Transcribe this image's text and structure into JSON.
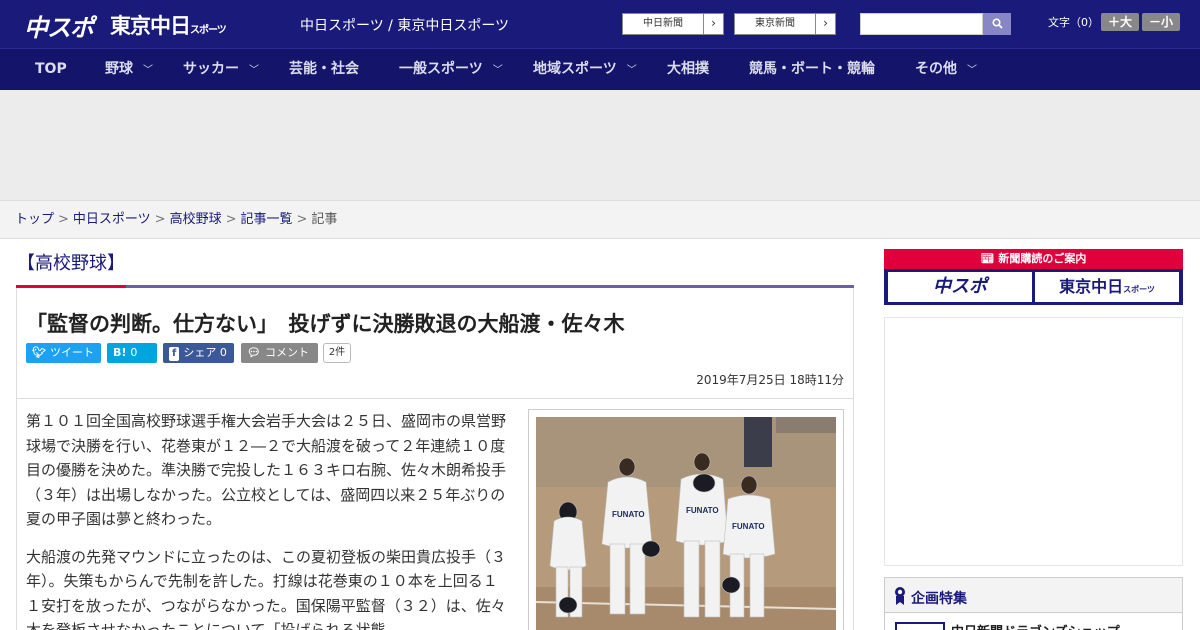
{
  "header": {
    "logo_chunichi": "中スポ",
    "logo_tokyo": "東京中日",
    "logo_tokyo_small": "スポーツ",
    "site_names": "中日スポーツ / 東京中日スポーツ",
    "link_chunichi_shimbun": "中日新聞",
    "link_tokyo_shimbun": "東京新聞",
    "search_placeholder": "",
    "fontsize_label": "文字（0）",
    "fontsize_up": "＋大",
    "fontsize_down": "－小"
  },
  "nav": {
    "items": [
      {
        "label": "TOP",
        "has_dropdown": false
      },
      {
        "label": "野球",
        "has_dropdown": true
      },
      {
        "label": "サッカー",
        "has_dropdown": true
      },
      {
        "label": "芸能・社会",
        "has_dropdown": false
      },
      {
        "label": "一般スポーツ",
        "has_dropdown": true
      },
      {
        "label": "地域スポーツ",
        "has_dropdown": true
      },
      {
        "label": "大相撲",
        "has_dropdown": false
      },
      {
        "label": "競馬・ボート・競輪",
        "has_dropdown": false
      },
      {
        "label": "その他",
        "has_dropdown": true
      }
    ]
  },
  "breadcrumb": {
    "items": [
      "トップ",
      "中日スポーツ",
      "高校野球",
      "記事一覧"
    ],
    "current": "記事",
    "separator": ">"
  },
  "article": {
    "category": "【高校野球】",
    "headline": "「監督の判断。仕方ない」　投げずに決勝敗退の大船渡・佐々木",
    "social": {
      "tweet": "ツイート",
      "hatena_icon": "B!",
      "hatena_count": "0",
      "facebook_label": "シェア",
      "facebook_count": "0",
      "comment_label": "コメント",
      "comment_count": "2件"
    },
    "date": "2019年7月25日 18時11分",
    "paragraphs": [
      "第１０１回全国高校野球選手権大会岩手大会は２５日、盛岡市の県営野球場で決勝を行い、花巻東が１２―２で大船渡を破って２年連続１０度目の優勝を決めた。準決勝で完投した１６３キロ右腕、佐々木朗希投手（３年）は出場しなかった。公立校としては、盛岡四以来２５年ぶりの夏の甲子園は夢と終わった。",
      "大船渡の先発マウンドに立ったのは、この夏初登板の柴田貴広投手（３年）。失策もからんで先制を許した。打線は花巻東の１０本を上回る１１安打を放ったが、つながらなかった。国保陽平監督（３２）は、佐々木を登板させなかったことについて「投げられる状態"
    ]
  },
  "sidebar": {
    "promo_title": "新聞購読のご案内",
    "promo_chunichi": "中スポ",
    "promo_tokyo": "東京中日",
    "promo_tokyo_small": "スポーツ",
    "feature_title": "企画特集",
    "feature_item": "中日新聞ドラゴンズショップ"
  },
  "colors": {
    "brand_navy": "#1a1a7a",
    "accent_red": "#e0003c",
    "accent_purple": "#6b5fa8",
    "twitter": "#1da1f2",
    "hatena": "#00a4de",
    "facebook": "#3b5998",
    "comment": "#888888"
  }
}
